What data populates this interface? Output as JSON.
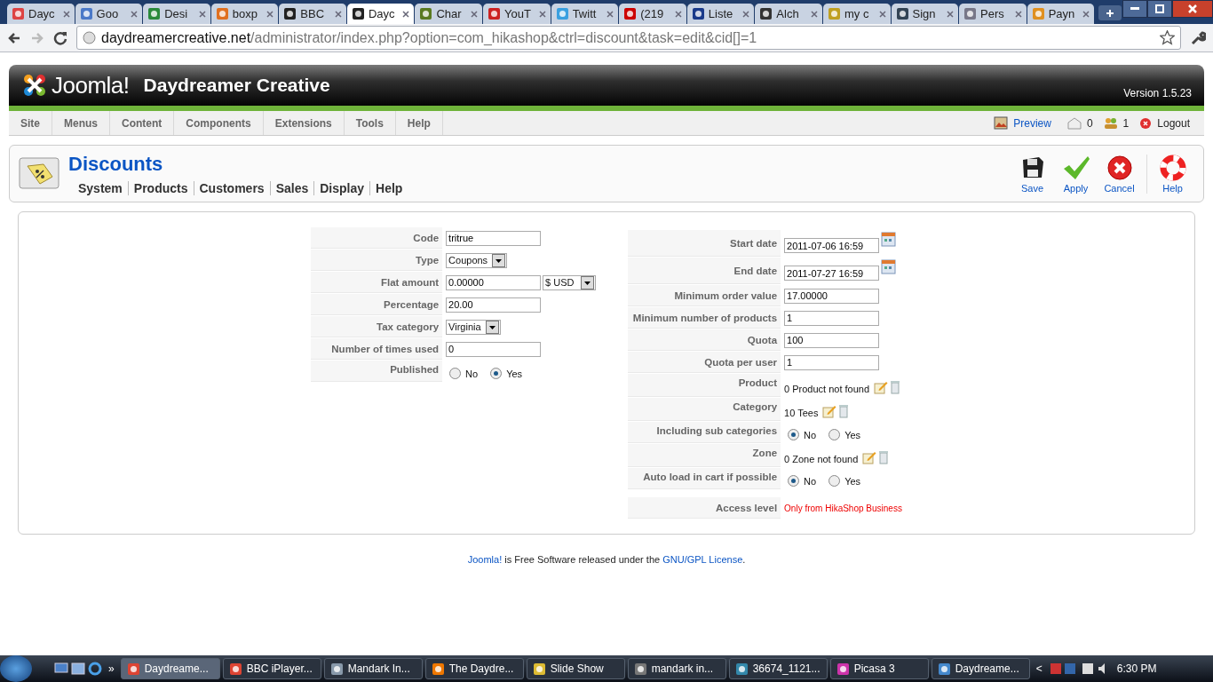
{
  "browser": {
    "tabs": [
      {
        "title": "Dayc",
        "selected": false
      },
      {
        "title": "Goo",
        "selected": false
      },
      {
        "title": "Desi",
        "selected": false
      },
      {
        "title": "boxp",
        "selected": false
      },
      {
        "title": "BBC",
        "selected": false
      },
      {
        "title": "Dayc",
        "selected": true
      },
      {
        "title": "Char",
        "selected": false
      },
      {
        "title": "YouT",
        "selected": false
      },
      {
        "title": "Twitt",
        "selected": false
      },
      {
        "title": "(219",
        "selected": false
      },
      {
        "title": "Liste",
        "selected": false
      },
      {
        "title": "Alch",
        "selected": false
      },
      {
        "title": "my c",
        "selected": false
      },
      {
        "title": "Sign",
        "selected": false
      },
      {
        "title": "Pers",
        "selected": false
      },
      {
        "title": "Payn",
        "selected": false
      }
    ],
    "url_host": "daydreamercreative.net",
    "url_path": "/administrator/index.php?option=com_hikashop&ctrl=discount&task=edit&cid[]=1"
  },
  "header": {
    "logo": "Joomla!",
    "site_name": "Daydreamer Creative",
    "version": "Version 1.5.23"
  },
  "menu": {
    "items": [
      "Site",
      "Menus",
      "Content",
      "Components",
      "Extensions",
      "Tools",
      "Help"
    ],
    "preview": "Preview",
    "messages": "0",
    "users": "1",
    "logout": "Logout"
  },
  "toolbar": {
    "title": "Discounts",
    "submenu": [
      "System",
      "Products",
      "Customers",
      "Sales",
      "Display",
      "Help"
    ],
    "buttons": [
      {
        "kind": "save",
        "label": "Save"
      },
      {
        "kind": "apply",
        "label": "Apply"
      },
      {
        "kind": "cancel",
        "label": "Cancel"
      },
      {
        "kind": "help",
        "label": "Help"
      }
    ]
  },
  "form": {
    "left": [
      {
        "kind": "text",
        "label": "Code",
        "value": "tritrue"
      },
      {
        "kind": "select",
        "label": "Type",
        "value": "Coupons"
      },
      {
        "kind": "amount",
        "label": "Flat amount",
        "value": "0.00000",
        "currency": "$ USD"
      },
      {
        "kind": "text",
        "label": "Percentage",
        "value": "20.00"
      },
      {
        "kind": "select",
        "label": "Tax category",
        "value": "Virginia"
      },
      {
        "kind": "text",
        "label": "Number of times used",
        "value": "0"
      },
      {
        "kind": "radio",
        "label": "Published",
        "options": [
          {
            "label": "No",
            "selected": false
          },
          {
            "label": "Yes",
            "selected": true
          }
        ]
      }
    ],
    "right": [
      {
        "kind": "date",
        "label": "Start date",
        "value": "2011-07-06 16:59"
      },
      {
        "kind": "date",
        "label": "End date",
        "value": "2011-07-27 16:59"
      },
      {
        "kind": "text",
        "label": "Minimum order value",
        "value": "17.00000"
      },
      {
        "kind": "text",
        "label": "Minimum number of products",
        "value": "1"
      },
      {
        "kind": "text",
        "label": "Quota",
        "value": "100"
      },
      {
        "kind": "text",
        "label": "Quota per user",
        "value": "1"
      },
      {
        "kind": "picker",
        "label": "Product",
        "value": "0 Product not found"
      },
      {
        "kind": "picker",
        "label": "Category",
        "value": "10 Tees"
      },
      {
        "kind": "radio",
        "label": "Including sub categories",
        "options": [
          {
            "label": "No",
            "selected": true
          },
          {
            "label": "Yes",
            "selected": false
          }
        ]
      },
      {
        "kind": "picker",
        "label": "Zone",
        "value": "0 Zone not found"
      },
      {
        "kind": "radio",
        "label": "Auto load in cart if possible",
        "options": [
          {
            "label": "No",
            "selected": true
          },
          {
            "label": "Yes",
            "selected": false
          }
        ]
      },
      {
        "kind": "notice",
        "label": "Access level",
        "value": "Only from HikaShop Business"
      }
    ]
  },
  "footer": {
    "link": "Joomla!",
    "text": " is Free Software released under the ",
    "license": "GNU/GPL License",
    "end": "."
  },
  "taskbar": {
    "more": "»",
    "tasks": [
      {
        "title": "Daydreame...",
        "selected": true
      },
      {
        "title": "BBC iPlayer...",
        "selected": false
      },
      {
        "title": "Mandark In...",
        "selected": false
      },
      {
        "title": "The Daydre...",
        "selected": false
      },
      {
        "title": "Slide Show",
        "selected": false
      },
      {
        "title": "mandark in...",
        "selected": false
      },
      {
        "title": "36674_1121...",
        "selected": false
      },
      {
        "title": "Picasa 3",
        "selected": false
      },
      {
        "title": "Daydreame...",
        "selected": false
      }
    ],
    "tray_toggle": "<",
    "clock": "6:30 PM"
  }
}
